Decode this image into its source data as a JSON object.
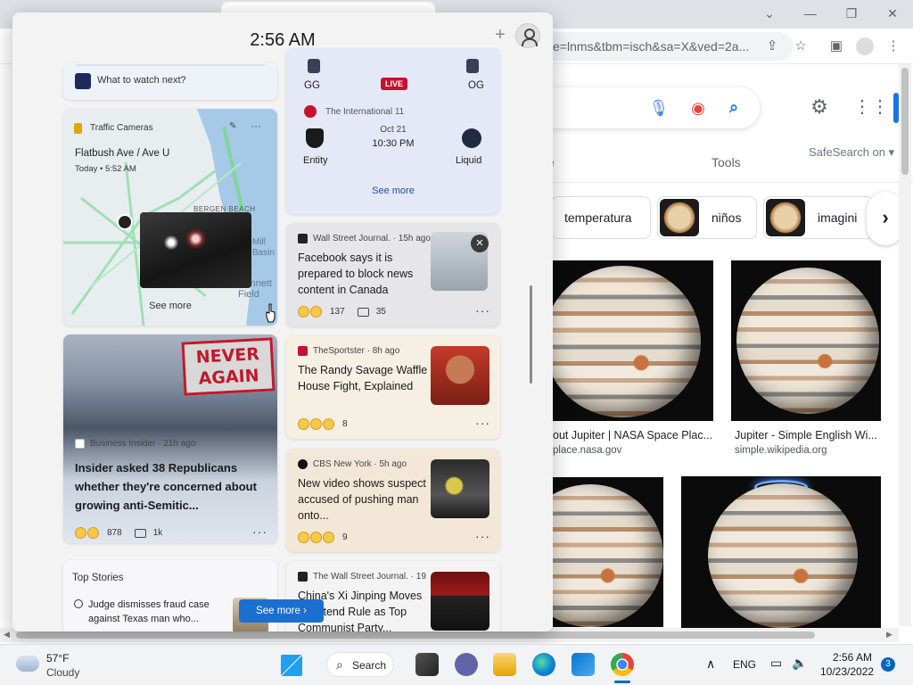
{
  "chrome": {
    "url_text": "e=lnms&tbm=isch&sa=X&ved=2a...",
    "tools_label": "Tools",
    "safesearch_label": "SafeSearch on",
    "partial_tab_label": "e",
    "chips": [
      {
        "label": "temperatura",
        "has_thumb": false
      },
      {
        "label": "niños",
        "has_thumb": true
      },
      {
        "label": "imagini",
        "has_thumb": true
      }
    ],
    "results": [
      {
        "title": "out Jupiter | NASA Space Plac...",
        "source": "place.nasa.gov"
      },
      {
        "title": "Jupiter - Simple English Wi...",
        "source": "simple.wikipedia.org"
      }
    ]
  },
  "widgets": {
    "clock": "2:56 AM",
    "watch_card": {
      "label": "What to watch next?"
    },
    "traffic": {
      "title": "Traffic Cameras",
      "location": "Flatbush Ave / Ave U",
      "timestamp": "Today • 5:52 AM",
      "see_more": "See more",
      "map_label": "BERGEN BEACH",
      "map_label2": "Mill Basin",
      "map_label3": "Bennett Field"
    },
    "esports": {
      "team1": "GG",
      "team2": "OG",
      "live_badge": "LIVE",
      "tournament": "The International 11",
      "date": "Oct 21",
      "time": "10:30 PM",
      "team3": "Entity",
      "team4": "Liquid",
      "see_more": "See more"
    },
    "news": [
      {
        "source": "Wall Street Journal. · 15h ago",
        "headline": "Facebook says it is prepared to block news content in Canada",
        "reactions": "137",
        "comments": "35"
      },
      {
        "source": "TheSportster · 8h ago",
        "headline": "The Randy Savage Waffle House Fight, Explained",
        "reactions": "8",
        "comments": ""
      },
      {
        "source": "CBS New York · 5h ago",
        "headline": "New video shows suspect accused of pushing man onto...",
        "reactions": "9",
        "comments": ""
      },
      {
        "source": "The Wall Street Journal. · 19",
        "headline": "China's Xi Jinping Moves to Extend Rule as Top Communist Party...",
        "reactions": "",
        "comments": ""
      }
    ],
    "feature": {
      "source": "Business Insider · 21h ago",
      "headline": "Insider asked 38 Republicans whether they're concerned about growing anti-Semitic...",
      "reactions": "878",
      "comments": "1k",
      "sign_line1": "NEVER",
      "sign_line2": "AGAIN"
    },
    "top_stories": {
      "title": "Top Stories",
      "item": "Judge dismisses fraud case against Texas man who..."
    },
    "see_more_button": "See more"
  },
  "taskbar": {
    "temp": "57°F",
    "condition": "Cloudy",
    "search_label": "Search",
    "lang": "ENG",
    "time": "2:56 AM",
    "date": "10/23/2022",
    "notif_count": "3"
  }
}
